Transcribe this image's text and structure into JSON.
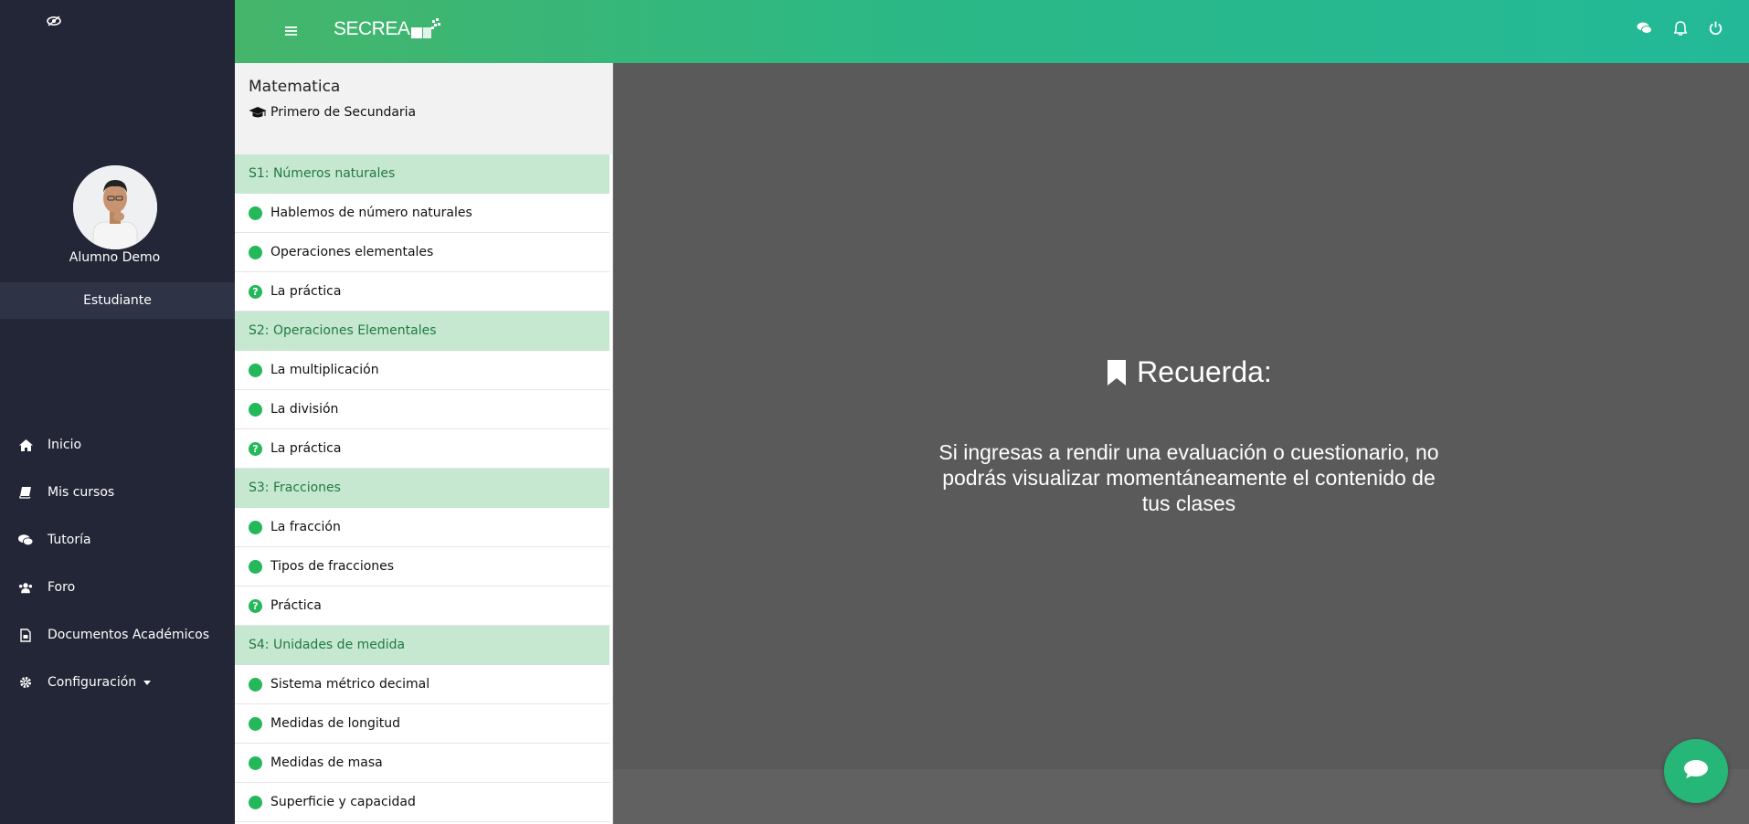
{
  "sidebar": {
    "user_name": "Alumno Demo",
    "role": "Estudiante",
    "nav": [
      {
        "label": "Inicio",
        "icon": "home-icon"
      },
      {
        "label": "Mis cursos",
        "icon": "book-icon"
      },
      {
        "label": "Tutoría",
        "icon": "chat-icon"
      },
      {
        "label": "Foro",
        "icon": "users-icon"
      },
      {
        "label": "Documentos Académicos",
        "icon": "document-icon"
      },
      {
        "label": "Configuración",
        "icon": "gear-icon"
      }
    ]
  },
  "header": {
    "logo_text": "SECREA"
  },
  "course": {
    "title": "Matematica",
    "level": "Primero de Secundaria",
    "sections": [
      {
        "title": "S1: Números naturales",
        "lessons": [
          "Hablemos de número naturales",
          "Operaciones elementales",
          "La práctica"
        ]
      },
      {
        "title": "S2: Operaciones Elementales",
        "lessons": [
          "La multiplicación",
          "La división",
          "La práctica"
        ]
      },
      {
        "title": "S3: Fracciones",
        "lessons": [
          "La fracción",
          "Tipos de fracciones",
          "Práctica"
        ]
      },
      {
        "title": "S4: Unidades de medida",
        "lessons": [
          "Sistema métrico decimal",
          "Medidas de longitud",
          "Medidas de masa",
          "Superficie y capacidad"
        ]
      }
    ]
  },
  "notice": {
    "heading": "Recuerda:",
    "text": "Si ingresas a rendir una evaluación o cuestionario, no podrás visualizar momentáneamente el contenido de tus clases"
  },
  "colors": {
    "sidebar_bg": "#232637",
    "header_gradient_start": "#45b56a",
    "header_gradient_end": "#23b998",
    "section_bg": "#c6e8d0",
    "section_text": "#217a41",
    "status_green": "#24b85a",
    "main_bg": "#5a5a5a"
  }
}
